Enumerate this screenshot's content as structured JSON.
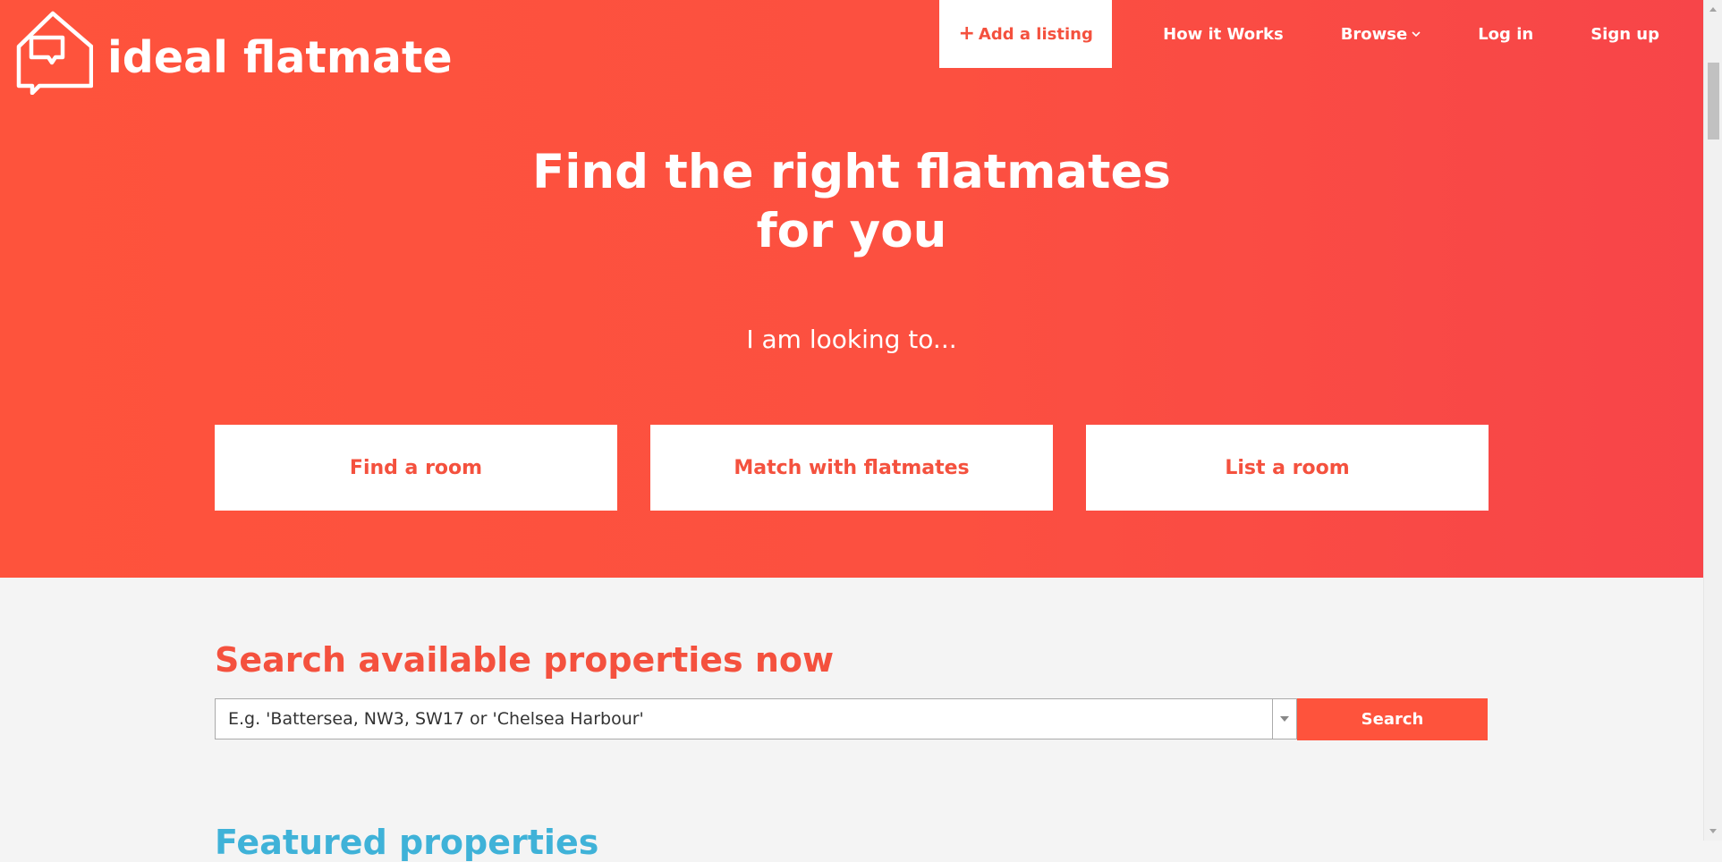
{
  "brand": {
    "name": "ideal flatmate",
    "logo_icon": "house-chat-bubble-icon"
  },
  "nav": {
    "add_listing": "Add a listing",
    "add_icon": "plus-icon",
    "how_it_works": "How it Works",
    "browse": "Browse",
    "browse_icon": "chevron-down-icon",
    "log_in": "Log in",
    "sign_up": "Sign up"
  },
  "hero": {
    "headline_line1": "Find the right flatmates",
    "headline_line2": "for you",
    "subheading": "I am looking to...",
    "options": [
      "Find a room",
      "Match with flatmates",
      "List a room"
    ]
  },
  "search": {
    "title": "Search available properties now",
    "placeholder": "E.g. 'Battersea, NW3, SW17 or 'Chelsea Harbour'",
    "button": "Search"
  },
  "featured": {
    "title": "Featured properties"
  },
  "colors": {
    "brand_coral": "#fe533c",
    "brand_red": "#f74549",
    "accent_blue": "#3fb2d8",
    "background": "#f4f4f4"
  }
}
